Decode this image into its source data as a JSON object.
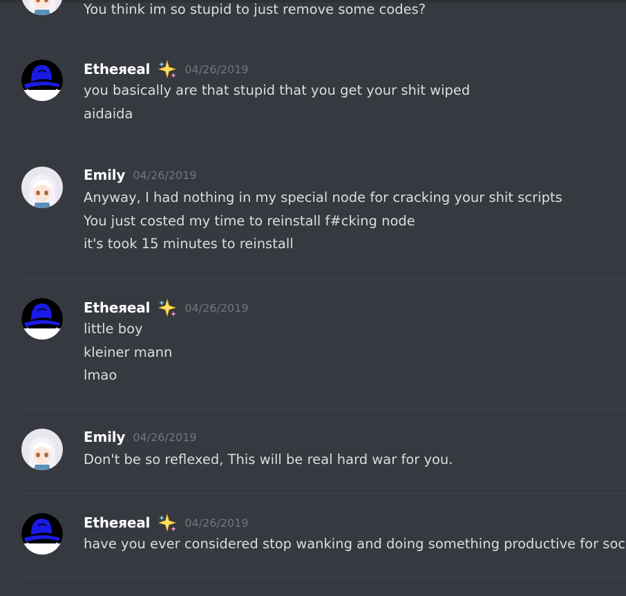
{
  "messages": [
    {
      "author": "",
      "timestamp": "",
      "avatar": "anime-girl-avatar",
      "sparkle": false,
      "lines": [
        "You think im so stupid to just remove some codes?"
      ]
    },
    {
      "author": "Etheяeal",
      "timestamp": "04/26/2019",
      "avatar": "blue-hat-avatar",
      "sparkle": true,
      "lines": [
        "you basically are that stupid that you get your shit wiped",
        "aidaida"
      ]
    },
    {
      "author": "Emily",
      "timestamp": "04/26/2019",
      "avatar": "anime-girl-avatar",
      "sparkle": false,
      "lines": [
        "Anyway, I had nothing in my special node for cracking your shit scripts",
        "You just costed my time to reinstall f#cking node",
        "it's took 15 minutes to reinstall"
      ]
    },
    {
      "author": "Etheяeal",
      "timestamp": "04/26/2019",
      "avatar": "blue-hat-avatar",
      "sparkle": true,
      "lines": [
        "little boy",
        "kleiner mann",
        "lmao"
      ]
    },
    {
      "author": "Emily",
      "timestamp": "04/26/2019",
      "avatar": "anime-girl-avatar",
      "sparkle": false,
      "lines": [
        "Don't be so reflexed, This will be real hard war for you."
      ]
    },
    {
      "author": "Etheяeal",
      "timestamp": "04/26/2019",
      "avatar": "blue-hat-avatar",
      "sparkle": true,
      "lines": [
        "have you ever considered stop wanking and doing something productive for society k"
      ]
    }
  ],
  "colors": {
    "background": "#36393f",
    "username": "#ffffff",
    "message_text": "#dcddde",
    "timestamp": "#72767d",
    "divider": "#3f4248",
    "hat_blue": "#1a1ae6"
  }
}
